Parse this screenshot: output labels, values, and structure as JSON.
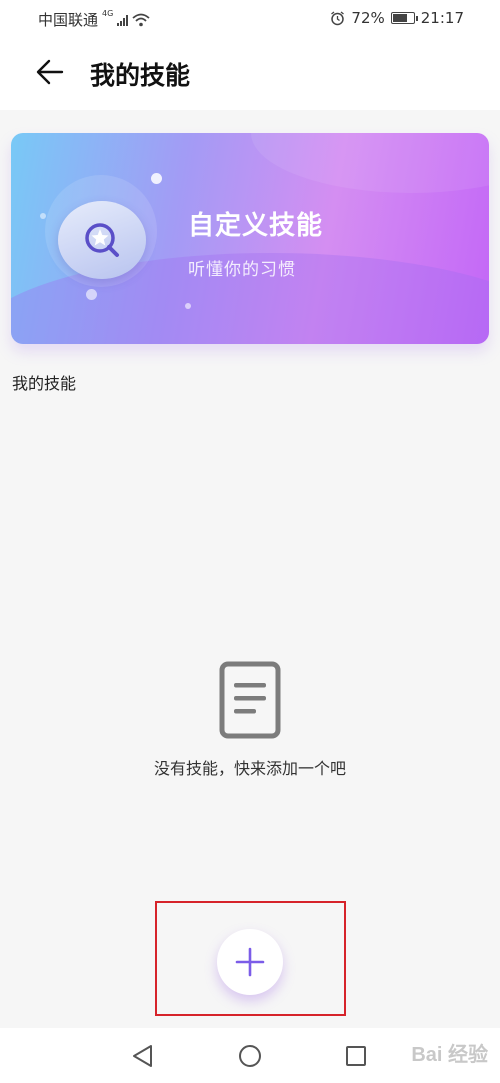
{
  "status_bar": {
    "carrier": "中国联通",
    "network": "4G",
    "battery": "72%",
    "battery_level": 0.72,
    "time": "21:17"
  },
  "header": {
    "title": "我的技能"
  },
  "banner": {
    "title": "自定义技能",
    "subtitle": "听懂你的习惯",
    "icon": "magic-wand-icon"
  },
  "section": {
    "label": "我的技能"
  },
  "empty_state": {
    "icon": "document-icon",
    "message": "没有技能，快来添加一个吧"
  },
  "add_button": {
    "icon": "plus-icon"
  },
  "nav_bar": {
    "icons": [
      "back-triangle-icon",
      "home-circle-icon",
      "recent-square-icon"
    ]
  },
  "watermark": {
    "text": "Bai 经验"
  },
  "colors": {
    "accent_purple": "#7b5ce8",
    "highlight_red": "#d6232a"
  }
}
